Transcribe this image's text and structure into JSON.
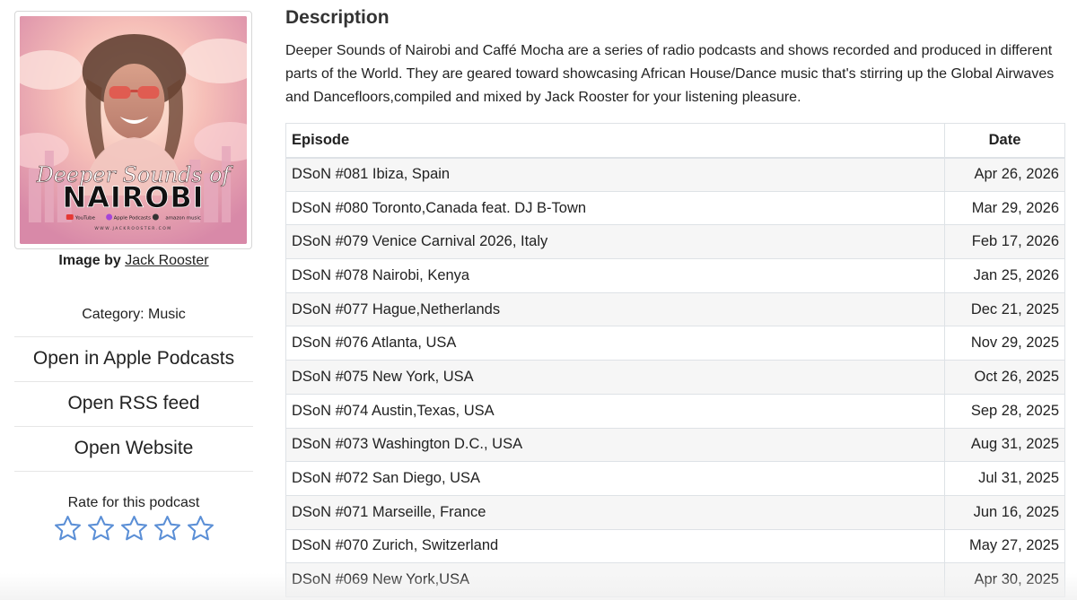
{
  "cover": {
    "title_script": "Deeper Sounds of",
    "title_main": "NAIROBI",
    "badges": [
      "YouTube",
      "Apple Podcasts",
      "amazon music"
    ],
    "website": "WWW.JACKROOSTER.COM"
  },
  "credit": {
    "label": "Image by",
    "author": "Jack Rooster"
  },
  "category": "Category: Music",
  "links": [
    {
      "label": "Open in Apple Podcasts"
    },
    {
      "label": "Open RSS feed"
    },
    {
      "label": "Open Website"
    }
  ],
  "rating": {
    "label": "Rate for this podcast",
    "stars_total": 5,
    "stars_filled": 0,
    "star_color": "#5b8fd6"
  },
  "description": {
    "title": "Description",
    "text": "Deeper Sounds of Nairobi and Caffé Mocha are a series of radio podcasts and shows recorded and produced in different parts of the World. They are geared toward showcasing African House/Dance music that's stirring up the Global Airwaves and Dancefloors,compiled and mixed by Jack Rooster for your listening pleasure."
  },
  "table": {
    "headers": {
      "episode": "Episode",
      "date": "Date"
    },
    "rows": [
      {
        "episode": "DSoN #081 Ibiza, Spain",
        "date": "Apr 26, 2026"
      },
      {
        "episode": "DSoN #080 Toronto,Canada feat. DJ B-Town",
        "date": "Mar 29, 2026"
      },
      {
        "episode": "DSoN #079 Venice Carnival 2026, Italy",
        "date": "Feb 17, 2026"
      },
      {
        "episode": "DSoN #078 Nairobi, Kenya",
        "date": "Jan 25, 2026"
      },
      {
        "episode": "DSoN #077 Hague,Netherlands",
        "date": "Dec 21, 2025"
      },
      {
        "episode": "DSoN #076 Atlanta, USA",
        "date": "Nov 29, 2025"
      },
      {
        "episode": "DSoN #075 New York, USA",
        "date": "Oct 26, 2025"
      },
      {
        "episode": "DSoN #074 Austin,Texas, USA",
        "date": "Sep 28, 2025"
      },
      {
        "episode": "DSoN #073 Washington D.C., USA",
        "date": "Aug 31, 2025"
      },
      {
        "episode": "DSoN #072 San Diego, USA",
        "date": "Jul 31, 2025"
      },
      {
        "episode": "DSoN #071 Marseille, France",
        "date": "Jun 16, 2025"
      },
      {
        "episode": "DSoN #070 Zurich, Switzerland",
        "date": "May 27, 2025"
      },
      {
        "episode": "DSoN #069 New York,USA",
        "date": "Apr 30, 2025"
      }
    ]
  }
}
